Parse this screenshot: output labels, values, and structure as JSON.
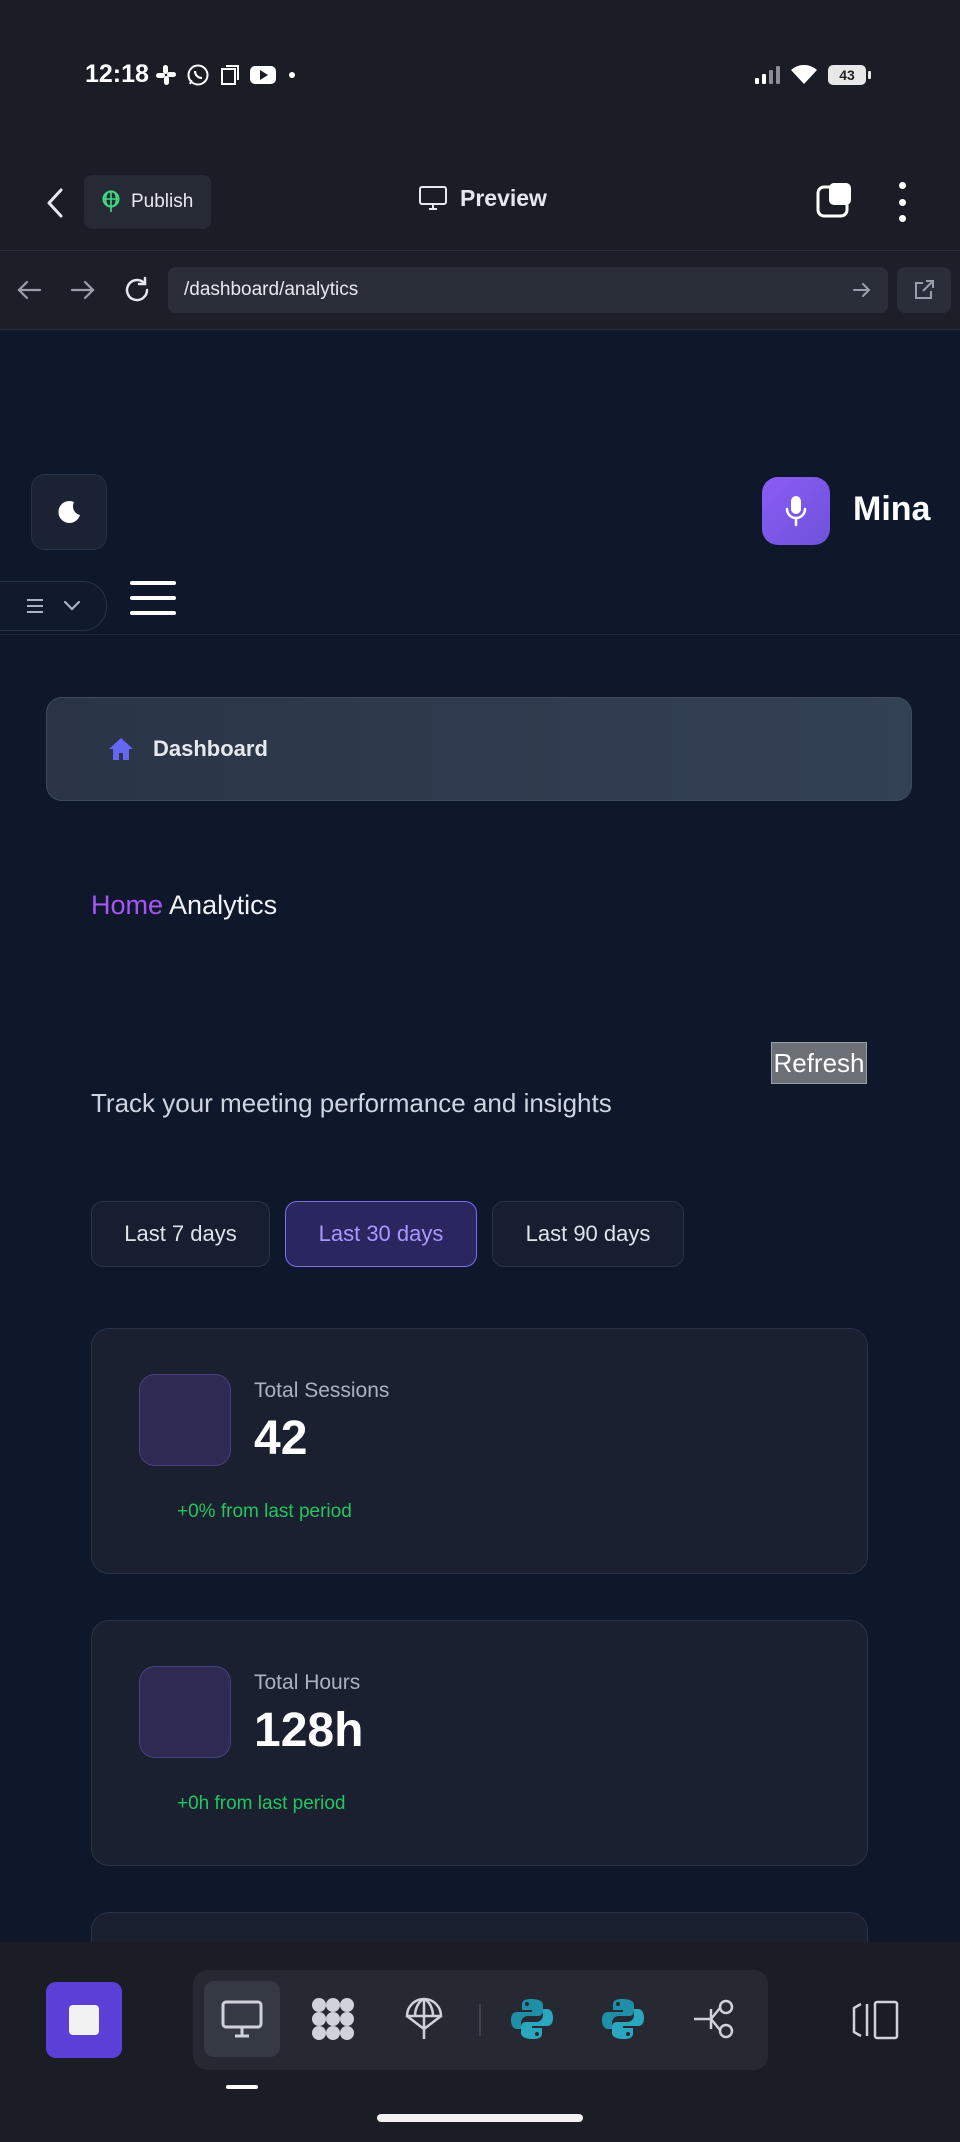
{
  "status_bar": {
    "time": "12:18",
    "battery": "43"
  },
  "editor_header": {
    "publish_label": "Publish",
    "preview_label": "Preview"
  },
  "browser": {
    "url": "/dashboard/analytics"
  },
  "app": {
    "user_name": "Mina",
    "nav_card_label": "Dashboard",
    "breadcrumb": {
      "home": "Home",
      "current": "Analytics"
    },
    "refresh_label": "Refresh",
    "subtitle": "Track your meeting performance and insights",
    "periods": [
      {
        "label": "Last 7 days",
        "active": false
      },
      {
        "label": "Last 30 days",
        "active": true
      },
      {
        "label": "Last 90 days",
        "active": false
      }
    ],
    "stats": [
      {
        "label": "Total Sessions",
        "value": "42",
        "change": "+0% from last period"
      },
      {
        "label": "Total Hours",
        "value": "128h",
        "change": "+0h from last period"
      }
    ]
  },
  "colors": {
    "accent": "#8b5cf6",
    "breadcrumb_home": "#a855f7",
    "positive": "#22c55e",
    "app_bg": "#0f172a"
  },
  "toolbar_icons": [
    "monitor-icon",
    "dots-grid-icon",
    "parachute-icon",
    "python-icon",
    "python-icon",
    "connect-icon"
  ]
}
